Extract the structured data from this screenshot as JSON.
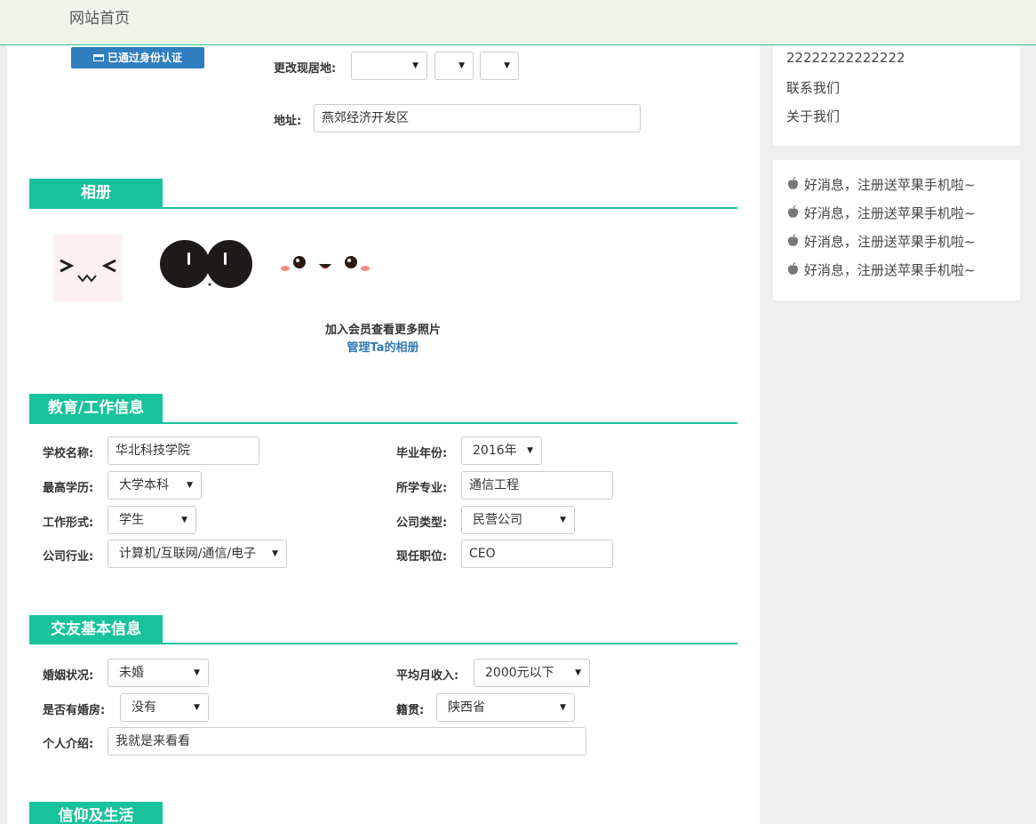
{
  "header": {
    "home": "网站首页"
  },
  "badge": {
    "label": "已通过身份认证"
  },
  "residence": {
    "label": "更改现居地:",
    "province": "",
    "city": "",
    "district": ""
  },
  "address": {
    "label": "地址:",
    "value": "燕郊经济开发区"
  },
  "album": {
    "title": "相册",
    "join_text": "加入会员查看更多照片",
    "manage_link": "管理Ta的相册"
  },
  "education": {
    "title": "教育/工作信息",
    "school_label": "学校名称:",
    "school_value": "华北科技学院",
    "grad_year_label": "毕业年份:",
    "grad_year_value": "2016年",
    "degree_label": "最高学历:",
    "degree_value": "大学本科",
    "major_label": "所学专业:",
    "major_value": "通信工程",
    "work_form_label": "工作形式:",
    "work_form_value": "学生",
    "company_type_label": "公司类型:",
    "company_type_value": "民营公司",
    "industry_label": "公司行业:",
    "industry_value": "计算机/互联网/通信/电子",
    "position_label": "现任职位:",
    "position_value": "CEO"
  },
  "dating": {
    "title": "交友基本信息",
    "marital_label": "婚姻状况:",
    "marital_value": "未婚",
    "income_label": "平均月收入:",
    "income_value": "2000元以下",
    "house_label": "是否有婚房:",
    "house_value": "没有",
    "origin_label": "籍贯:",
    "origin_value": "陕西省",
    "intro_label": "个人介绍:",
    "intro_value": "我就是来看看"
  },
  "faith": {
    "title": "信仰及生活"
  },
  "sidebar": {
    "number": "22222222222222",
    "contact": "联系我们",
    "about": "关于我们",
    "news": [
      "好消息，注册送苹果手机啦~",
      "好消息，注册送苹果手机啦~",
      "好消息，注册送苹果手机啦~",
      "好消息，注册送苹果手机啦~"
    ]
  },
  "colors": {
    "accent": "#18c39c",
    "link": "#337ab7",
    "badge": "#2f7ebf",
    "header_bg": "#eef5e9"
  },
  "icons": {
    "badge": "id-card-icon",
    "news": "apple-icon",
    "select": "caret-down-icon"
  }
}
